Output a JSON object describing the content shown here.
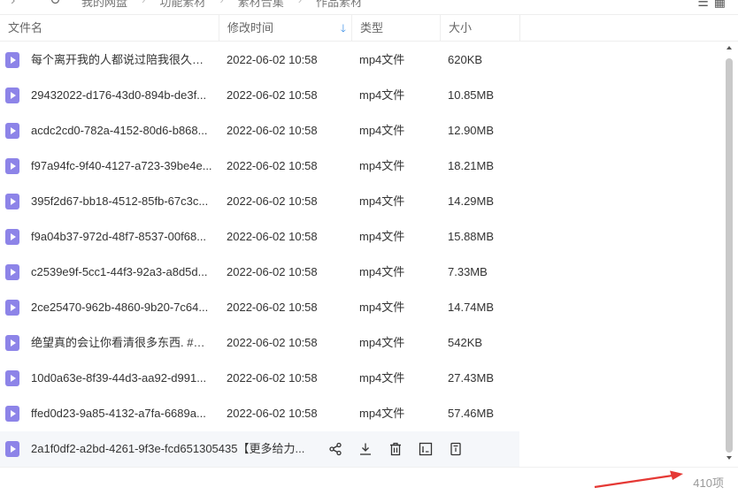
{
  "topbar": {
    "crumbs": [
      "我的网盘",
      "功能素材",
      "素材合集",
      "作品素材"
    ]
  },
  "table": {
    "headers": {
      "name": "文件名",
      "time": "修改时间",
      "type": "类型",
      "size": "大小"
    },
    "rows": [
      {
        "name": "每个离开我的人都说过陪我很久很久...",
        "time": "2022-06-02 10:58",
        "type": "mp4文件",
        "size": "620KB"
      },
      {
        "name": "29432022-d176-43d0-894b-de3f...",
        "time": "2022-06-02 10:58",
        "type": "mp4文件",
        "size": "10.85MB"
      },
      {
        "name": "acdc2cd0-782a-4152-80d6-b868...",
        "time": "2022-06-02 10:58",
        "type": "mp4文件",
        "size": "12.90MB"
      },
      {
        "name": "f97a94fc-9f40-4127-a723-39be4e...",
        "time": "2022-06-02 10:58",
        "type": "mp4文件",
        "size": "18.21MB"
      },
      {
        "name": "395f2d67-bb18-4512-85fb-67c3c...",
        "time": "2022-06-02 10:58",
        "type": "mp4文件",
        "size": "14.29MB"
      },
      {
        "name": "f9a04b37-972d-48f7-8537-00f68...",
        "time": "2022-06-02 10:58",
        "type": "mp4文件",
        "size": "15.88MB"
      },
      {
        "name": "c2539e9f-5cc1-44f3-92a3-a8d5d...",
        "time": "2022-06-02 10:58",
        "type": "mp4文件",
        "size": "7.33MB"
      },
      {
        "name": "2ce25470-962b-4860-9b20-7c64...",
        "time": "2022-06-02 10:58",
        "type": "mp4文件",
        "size": "14.74MB"
      },
      {
        "name": "绝望真的会让你看清很多东西. #我...",
        "time": "2022-06-02 10:58",
        "type": "mp4文件",
        "size": "542KB"
      },
      {
        "name": "10d0a63e-8f39-44d3-aa92-d991...",
        "time": "2022-06-02 10:58",
        "type": "mp4文件",
        "size": "27.43MB"
      },
      {
        "name": "ffed0d23-9a85-4132-a7fa-6689a...",
        "time": "2022-06-02 10:58",
        "type": "mp4文件",
        "size": "57.46MB"
      },
      {
        "name": "2a1f0df2-a2bd-4261-9f3e-fcd651305435【更多给力...",
        "time": "",
        "type": "",
        "size": ""
      }
    ]
  },
  "footer": {
    "item_count": "410项"
  },
  "colors": {
    "file_icon": "#8d84e8",
    "sort_accent": "#3a8ee6",
    "arrow": "#e53935"
  }
}
